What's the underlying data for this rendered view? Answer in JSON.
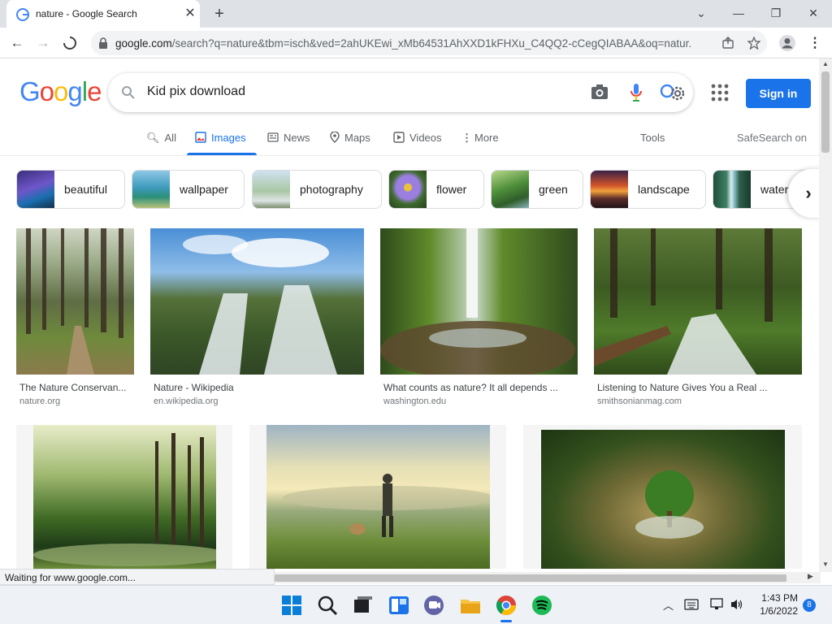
{
  "browser": {
    "tab_title": "nature - Google Search",
    "url_domain": "google.com",
    "url_rest": "/search?q=nature&tbm=isch&ved=2ahUKEwi_xMb64531AhXXD1kFHXu_C4QQ2-cCegQIABAA&oq=natur...",
    "status_text": "Waiting for www.google.com..."
  },
  "google": {
    "search_value": "Kid pix download",
    "sign_in": "Sign in",
    "tabs": {
      "all": "All",
      "images": "Images",
      "news": "News",
      "maps": "Maps",
      "videos": "Videos",
      "more": "More"
    },
    "tools": "Tools",
    "safesearch": "SafeSearch on",
    "chips": [
      "beautiful",
      "wallpaper",
      "photography",
      "flower",
      "green",
      "landscape",
      "water"
    ]
  },
  "results": [
    {
      "caption": "The Nature Conservan...",
      "source": "nature.org"
    },
    {
      "caption": "Nature - Wikipedia",
      "source": "en.wikipedia.org"
    },
    {
      "caption": "What counts as nature? It all depends ...",
      "source": "washington.edu"
    },
    {
      "caption": "Listening to Nature Gives You a Real ...",
      "source": "smithsonianmag.com"
    }
  ],
  "taskbar": {
    "time": "1:43 PM",
    "date": "1/6/2022",
    "notifications": "8"
  },
  "colors": {
    "accent": "#1a73e8",
    "logo_blue": "#4285f4",
    "logo_red": "#ea4335",
    "logo_yellow": "#fbbc05",
    "logo_green": "#34a853"
  }
}
